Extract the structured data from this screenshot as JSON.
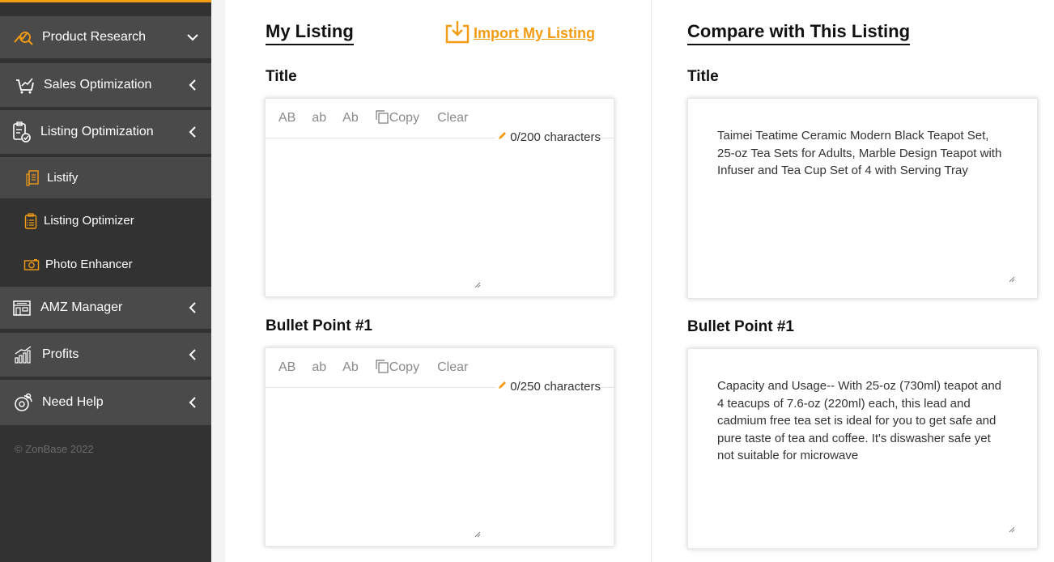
{
  "sidebar": {
    "items": [
      {
        "label": "Product Research",
        "icon": "chart-search-icon",
        "chevron": "down"
      },
      {
        "label": "Sales Optimization",
        "icon": "cart-chart-icon",
        "chevron": "left"
      },
      {
        "label": "Listing Optimization",
        "icon": "clipboard-check-icon",
        "chevron": "left"
      },
      {
        "label": "Listify",
        "icon": "list-doc-icon"
      },
      {
        "label": "Listing Optimizer",
        "icon": "checklist-icon"
      },
      {
        "label": "Photo Enhancer",
        "icon": "camera-icon"
      },
      {
        "label": "AMZ Manager",
        "icon": "store-icon",
        "chevron": "left"
      },
      {
        "label": "Profits",
        "icon": "bar-growth-icon",
        "chevron": "left"
      },
      {
        "label": "Need Help",
        "icon": "support-icon",
        "chevron": "left"
      }
    ],
    "footer": "© ZonBase 2022"
  },
  "colors": {
    "accent": "#f39c12",
    "sidebar_bg": "#323232",
    "section_bg": "#4a4a4a"
  },
  "my_listing": {
    "heading": "My Listing",
    "import_label": "Import My Listing",
    "title_label": "Title",
    "bullet1_label": "Bullet Point #1",
    "toolbar": {
      "upper": "AB",
      "lower": "ab",
      "capital": "Ab",
      "copy": "Copy",
      "clear": "Clear"
    },
    "title_counter": "0/200 characters",
    "bullet1_counter": "0/250 characters",
    "title_value": "",
    "bullet1_value": ""
  },
  "compare": {
    "heading": "Compare with This Listing",
    "title_label": "Title",
    "bullet1_label": "Bullet Point #1",
    "title_text": "Taimei Teatime Ceramic Modern Black Teapot Set, 25-oz Tea Sets for Adults, Marble Design Teapot with Infuser and Tea Cup Set of 4 with Serving Tray",
    "bullet1_text": "Capacity and Usage-- With 25-oz (730ml) teapot and 4 teacups of 7.6-oz (220ml) each, this lead and cadmium free tea set is ideal for you to get safe and pure taste of tea and coffee. It's diswasher safe yet not suitable for microwave"
  }
}
